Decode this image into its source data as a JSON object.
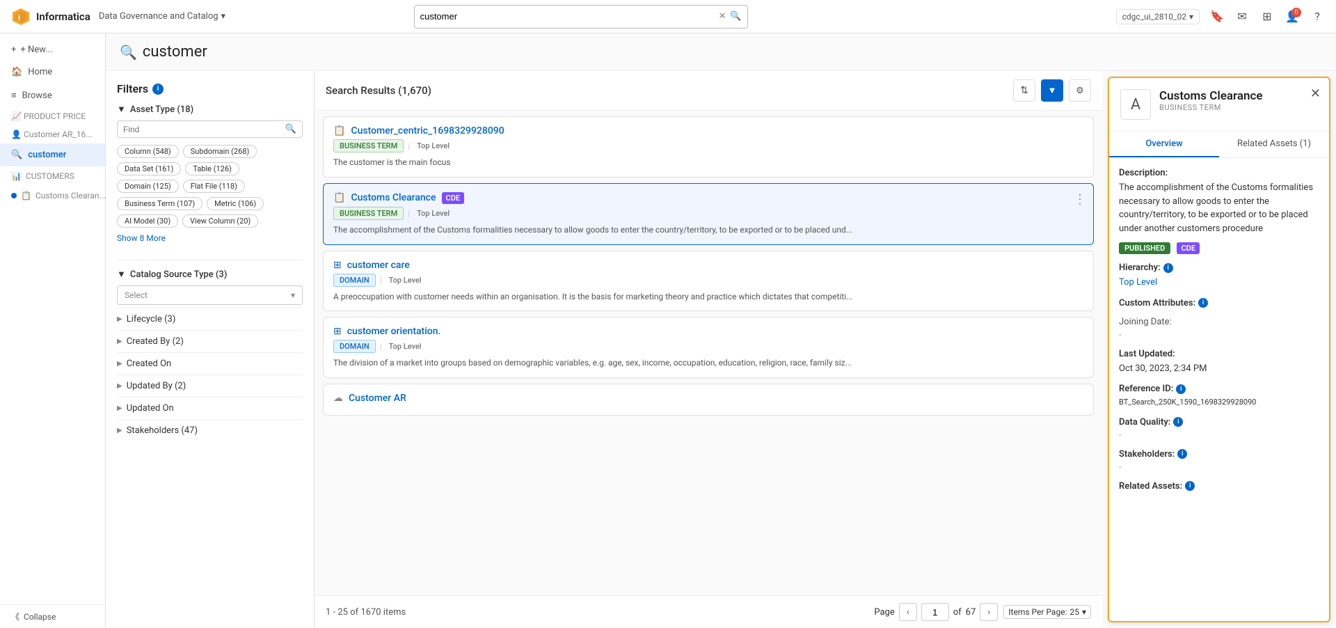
{
  "topNav": {
    "logoText": "Informatica",
    "appName": "Data Governance and Catalog",
    "searchPlaceholder": "customer",
    "searchValue": "customer",
    "environment": "cdgc_ui_2810_02"
  },
  "sidebar": {
    "newButton": "+ New...",
    "items": [
      {
        "id": "home",
        "label": "Home",
        "icon": "🏠",
        "active": false
      },
      {
        "id": "browse",
        "label": "Browse",
        "icon": "≡",
        "active": false
      }
    ],
    "recentLabel": "PRODUCT PRICE",
    "recentLabel2": "Customer AR_16...",
    "activeSearch": "customer",
    "historyItems": [
      {
        "id": "customers",
        "label": "CUSTOMERS",
        "hasDot": true
      },
      {
        "id": "customs",
        "label": "Customs Clearan...",
        "hasDot": false
      }
    ],
    "collapseLabel": "Collapse"
  },
  "filters": {
    "title": "Filters",
    "assetTypeSection": "Asset Type (18)",
    "findPlaceholder": "Find",
    "tags": [
      "Column (548)",
      "Subdomain (268)",
      "Data Set (161)",
      "Table (126)",
      "Domain (125)",
      "Flat File (118)",
      "Business Term (107)",
      "Metric (106)",
      "AI Model (30)",
      "View Column (20)"
    ],
    "showMoreLabel": "Show 8 More",
    "catalogSourceSection": "Catalog Source Type (3)",
    "selectPlaceholder": "Select",
    "collapsibles": [
      "Lifecycle (3)",
      "Created By (2)",
      "Created On",
      "Updated By (2)",
      "Updated On",
      "Stakeholders (47)"
    ]
  },
  "results": {
    "title": "Search Results (1,670)",
    "cards": [
      {
        "id": 1,
        "icon": "📋",
        "title": "Customer_centric_1698329928090",
        "type": "BUSINESS TERM",
        "level": "Top Level",
        "cde": false,
        "description": "The customer is the main focus"
      },
      {
        "id": 2,
        "icon": "📋",
        "title": "Customs Clearance",
        "type": "BUSINESS TERM",
        "level": "Top Level",
        "cde": true,
        "description": "The accomplishment of the Customs formalities necessary to allow goods to enter the country/territory, to be exported or to be placed und...",
        "selected": true
      },
      {
        "id": 3,
        "icon": "🔷",
        "title": "customer care",
        "type": "DOMAIN",
        "level": "Top Level",
        "cde": false,
        "description": "A preoccupation with customer needs within an organisation. It is the basis for marketing theory and practice which dictates that competiti..."
      },
      {
        "id": 4,
        "icon": "🔷",
        "title": "customer orientation.",
        "type": "DOMAIN",
        "level": "Top Level",
        "cde": false,
        "description": "The division of a market into groups based on demographic variables, e.g. age, sex, income, occupation, education, religion, race, family siz..."
      },
      {
        "id": 5,
        "icon": "☁",
        "title": "Customer AR",
        "type": "",
        "level": "",
        "cde": false,
        "description": ""
      }
    ],
    "pagination": {
      "info": "1 - 25 of 1670 items",
      "pageLabel": "Page",
      "currentPage": "1",
      "totalPages": "67",
      "itemsPerPageLabel": "Items Per Page:",
      "itemsPerPage": "25"
    }
  },
  "detail": {
    "title": "Customs Clearance",
    "subtitle": "BUSINESS TERM",
    "iconLabel": "A",
    "tabs": [
      "Overview",
      "Related Assets (1)"
    ],
    "activeTab": "Overview",
    "description": {
      "label": "Description:",
      "value": "The accomplishment of the Customs formalities necessary to allow goods to enter the country/territory, to be exported or to be placed under another customers procedure"
    },
    "badges": [
      "PUBLISHED",
      "CDE"
    ],
    "hierarchy": {
      "label": "Hierarchy:",
      "value": "Top Level"
    },
    "customAttributes": {
      "label": "Custom Attributes:",
      "joiningDate": {
        "label": "Joining Date:",
        "value": "-"
      }
    },
    "lastUpdated": {
      "label": "Last Updated:",
      "value": "Oct 30, 2023, 2:34 PM"
    },
    "referenceId": {
      "label": "Reference ID:",
      "value": "BT_Search_250K_1590_1698329928090"
    },
    "dataQuality": {
      "label": "Data Quality:",
      "value": "-"
    },
    "stakeholders": {
      "label": "Stakeholders:",
      "value": "-"
    },
    "relatedAssets": {
      "label": "Related Assets:"
    }
  }
}
